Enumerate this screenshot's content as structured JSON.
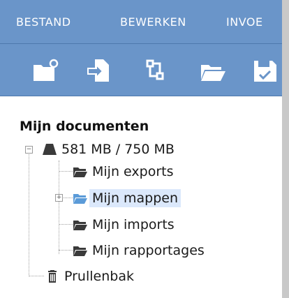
{
  "menu": {
    "items": [
      {
        "label": "BESTAND"
      },
      {
        "label": "BEWERKEN"
      },
      {
        "label": "INVOE"
      }
    ]
  },
  "toolbar": {
    "tools": [
      {
        "icon": "new-folder-icon"
      },
      {
        "icon": "import-icon"
      },
      {
        "icon": "move-icon"
      },
      {
        "icon": "open-folder-icon"
      },
      {
        "icon": "save-icon"
      }
    ]
  },
  "tree": {
    "root_label": "Mijn documenten",
    "storage_label": "581 MB / 750 MB",
    "nodes": [
      {
        "label": "Mijn exports",
        "icon": "folder-icon"
      },
      {
        "label": "Mijn mappen",
        "icon": "folder-open-icon",
        "selected": true,
        "expandable": true
      },
      {
        "label": "Mijn imports",
        "icon": "folder-icon"
      },
      {
        "label": "Mijn rapportages",
        "icon": "folder-icon"
      }
    ],
    "trash_label": "Prullenbak",
    "toggle_collapse": "−",
    "toggle_expand": "+"
  },
  "colors": {
    "menu_bg": "#6a95c9",
    "selection": "#dbe8fb",
    "folder_dark": "#3a3a3a",
    "folder_blue": "#5b9bd8"
  }
}
